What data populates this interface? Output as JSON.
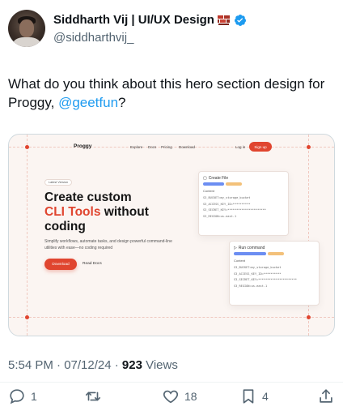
{
  "author": {
    "name": "Siddharth Vij | UI/UX Design",
    "handle": "@siddharthvij_"
  },
  "tweet": {
    "text_before": "What do you think about this hero section design for Proggy, ",
    "mention": "@geetfun",
    "text_after": "?"
  },
  "media": {
    "nav": {
      "logo": "Proggy",
      "links": [
        "Explore",
        "Docs",
        "Pricing",
        "Download"
      ],
      "login": "Log in",
      "signup": "Sign up"
    },
    "badge": "Latest Version",
    "headline_line1": "Create custom",
    "headline_accent": "CLI Tools",
    "headline_rest": " without",
    "headline_line3": "coding",
    "subtext": "Simplify workflows, automate tasks, and design powerful command-line utilities with ease—no coding required",
    "primary_button": "Download",
    "secondary_button": "Read Docs",
    "card1": {
      "title": "Create File",
      "content_label": "Content",
      "lines": [
        "S3_BUCKET=my_storage_bucket",
        "S3_ACCESS_KEY_ID=**********",
        "S3_SECRET_KEY=**********************",
        "S3_REGION=us-east-1"
      ]
    },
    "card2": {
      "title": "Run command",
      "content_label": "Content",
      "lines": [
        "S3_BUCKET=my_storage_bucket",
        "S3_ACCESS_KEY_ID=**********",
        "S3_SECRET_KEY=**********************",
        "S3_REGION=us-east-1"
      ]
    },
    "accent_color": "#e0452f"
  },
  "meta": {
    "time": "5:54 PM · 07/12/24 · ",
    "views_count": "923",
    "views_label": " Views"
  },
  "actions": {
    "replies": "1",
    "reposts": "",
    "likes": "18",
    "bookmarks": "4"
  },
  "colors": {
    "link": "#1d9bf0",
    "muted": "#536471",
    "verified": "#1d9bf0"
  }
}
